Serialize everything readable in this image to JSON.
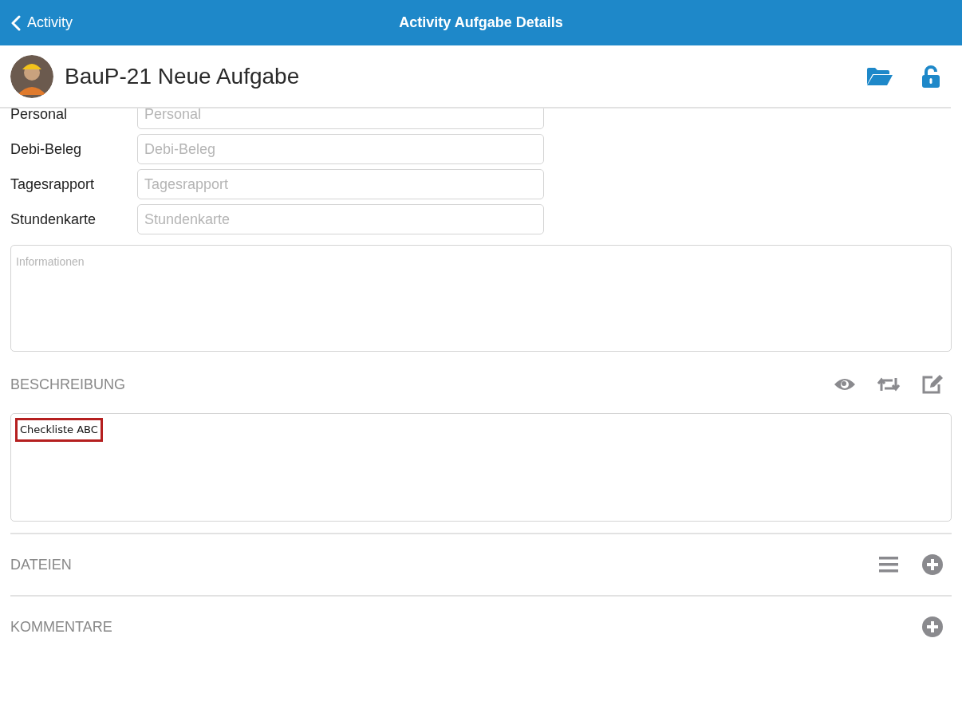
{
  "nav": {
    "back_label": "Activity",
    "title": "Activity Aufgabe Details"
  },
  "header": {
    "title": "BauP-21 Neue Aufgabe"
  },
  "fields": [
    {
      "label": "Personal",
      "placeholder": "Personal"
    },
    {
      "label": "Debi-Beleg",
      "placeholder": "Debi-Beleg"
    },
    {
      "label": "Tagesrapport",
      "placeholder": "Tagesrapport"
    },
    {
      "label": "Stundenkarte",
      "placeholder": "Stundenkarte"
    }
  ],
  "informationen": {
    "placeholder": "Informationen"
  },
  "beschreibung": {
    "heading": "BESCHREIBUNG",
    "content": "Checkliste ABC",
    "highlighted": true
  },
  "dateien": {
    "heading": "DATEIEN"
  },
  "kommentare": {
    "heading": "KOMMENTARE"
  }
}
